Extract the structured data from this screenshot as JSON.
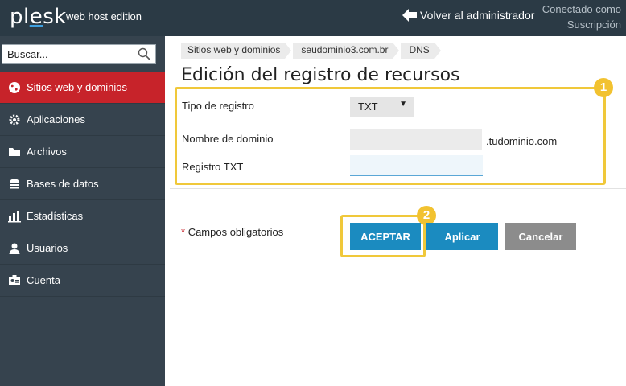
{
  "brand": {
    "logo": "plesk",
    "edition": "web host edition"
  },
  "topbar": {
    "back_label": "Volver al administrador",
    "connected_line1": "Conectado como",
    "connected_line2": "Suscripción"
  },
  "search": {
    "placeholder": "Buscar..."
  },
  "sidebar": {
    "items": [
      {
        "label": "Sitios web y dominios",
        "icon": "globe-icon",
        "active": true
      },
      {
        "label": "Aplicaciones",
        "icon": "gear-icon",
        "active": false
      },
      {
        "label": "Archivos",
        "icon": "folder-icon",
        "active": false
      },
      {
        "label": "Bases de datos",
        "icon": "database-icon",
        "active": false
      },
      {
        "label": "Estadísticas",
        "icon": "bar-chart-icon",
        "active": false
      },
      {
        "label": "Usuarios",
        "icon": "user-icon",
        "active": false
      },
      {
        "label": "Cuenta",
        "icon": "account-icon",
        "active": false
      }
    ]
  },
  "breadcrumb": [
    "Sitios web y dominios",
    "seudominio3.com.br",
    "DNS"
  ],
  "page": {
    "title": "Edición del registro de recursos"
  },
  "form": {
    "record_type_label": "Tipo de registro",
    "record_type_value": "TXT",
    "domain_name_label": "Nombre de dominio",
    "domain_name_value": "",
    "domain_suffix": ".tudominio.com",
    "txt_record_label": "Registro TXT",
    "txt_record_value": ""
  },
  "required_note": {
    "star": "*",
    "text": "Campos obligatorios"
  },
  "buttons": {
    "accept": "ACEPTAR",
    "apply": "Aplicar",
    "cancel": "Cancelar"
  },
  "annotations": {
    "badge1": "1",
    "badge2": "2"
  },
  "colors": {
    "topbar": "#2b3a45",
    "sidebar": "#36434e",
    "active": "#c7232a",
    "highlight": "#f0c83a",
    "primary": "#1b8bc0",
    "secondary": "#8c8c8c"
  }
}
